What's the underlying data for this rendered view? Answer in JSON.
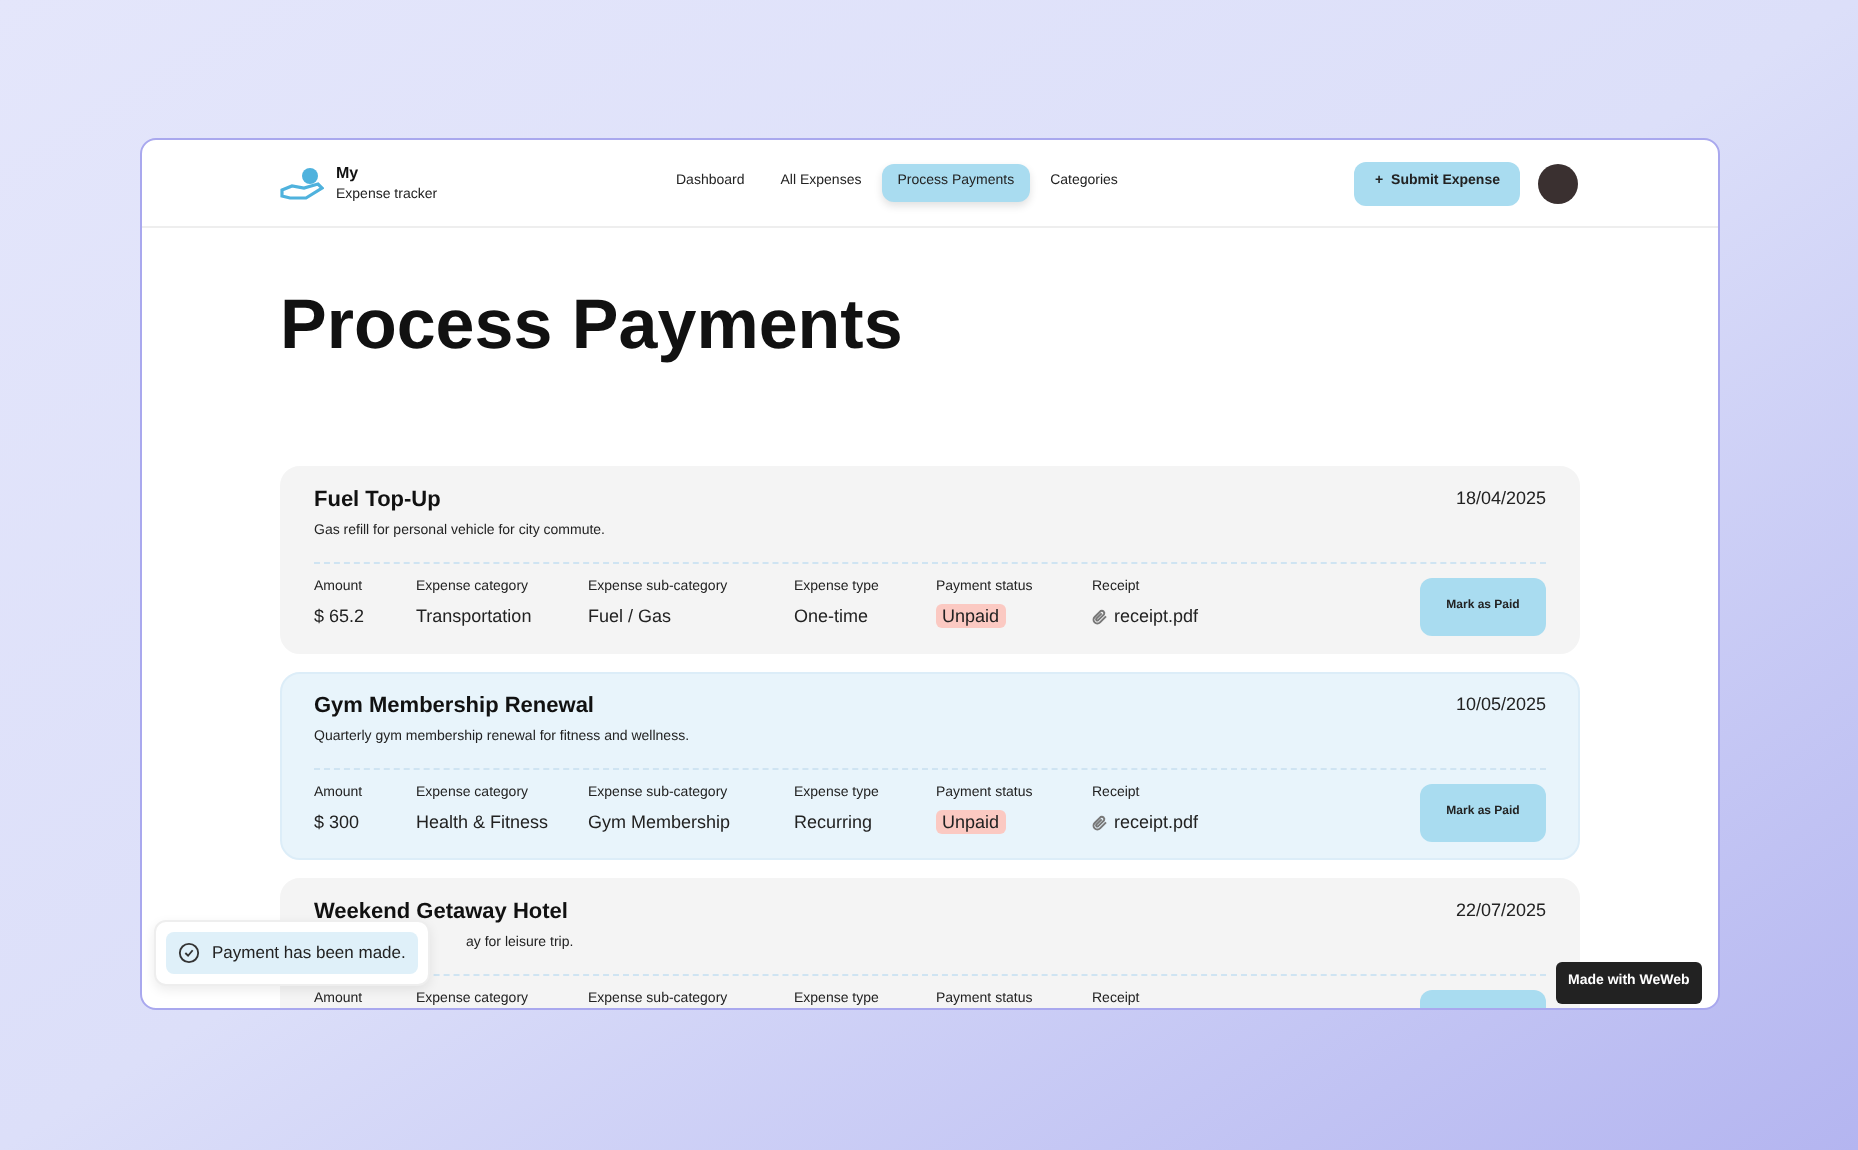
{
  "app": {
    "logo_title": "My",
    "logo_subtitle": "Expense tracker"
  },
  "nav": [
    {
      "label": "Dashboard",
      "selected": false
    },
    {
      "label": "All Expenses",
      "selected": false
    },
    {
      "label": "Process Payments",
      "selected": true
    },
    {
      "label": "Categories",
      "selected": false
    }
  ],
  "submit_button": {
    "icon": "+",
    "label": "Submit Expense"
  },
  "page_title": "Process Payments",
  "expenses": [
    {
      "title": "Fuel Top-Up",
      "description": "Gas refill for personal vehicle for city commute.",
      "date": "18/04/2025",
      "highlighted": false,
      "fields": [
        {
          "label": "Amount",
          "value": "$ 65.2",
          "kind": "text"
        },
        {
          "label": "Expense category",
          "value": "Transportation",
          "kind": "text"
        },
        {
          "label": "Expense sub-category",
          "value": "Fuel / Gas",
          "kind": "text"
        },
        {
          "label": "Expense type",
          "value": "One-time",
          "kind": "text"
        },
        {
          "label": "Payment status",
          "value": "Unpaid",
          "kind": "status"
        },
        {
          "label": "Receipt",
          "value": "receipt.pdf",
          "kind": "file"
        }
      ],
      "button": "Mark as Paid"
    },
    {
      "title": "Gym Membership Renewal",
      "description": "Quarterly gym membership renewal for fitness and wellness.",
      "date": "10/05/2025",
      "highlighted": true,
      "fields": [
        {
          "label": "Amount",
          "value": "$ 300",
          "kind": "text"
        },
        {
          "label": "Expense category",
          "value": "Health & Fitness",
          "kind": "text"
        },
        {
          "label": "Expense sub-category",
          "value": "Gym Membership",
          "kind": "text"
        },
        {
          "label": "Expense type",
          "value": "Recurring",
          "kind": "text"
        },
        {
          "label": "Payment status",
          "value": "Unpaid",
          "kind": "status"
        },
        {
          "label": "Receipt",
          "value": "receipt.pdf",
          "kind": "file"
        }
      ],
      "button": "Mark as Paid"
    },
    {
      "title": "Weekend Getaway Hotel",
      "description": "ay for leisure trip.",
      "description_covered": true,
      "date": "22/07/2025",
      "highlighted": false,
      "fields": [
        {
          "label": "Amount",
          "kind": "text"
        },
        {
          "label": "Expense category",
          "kind": "text"
        },
        {
          "label": "Expense sub-category",
          "kind": "text"
        },
        {
          "label": "Expense type",
          "kind": "text"
        },
        {
          "label": "Payment status",
          "kind": "status"
        },
        {
          "label": "Receipt",
          "kind": "file"
        }
      ]
    }
  ],
  "toast": {
    "message": "Payment has been made."
  },
  "badge": {
    "label": "Made with WeWeb"
  }
}
